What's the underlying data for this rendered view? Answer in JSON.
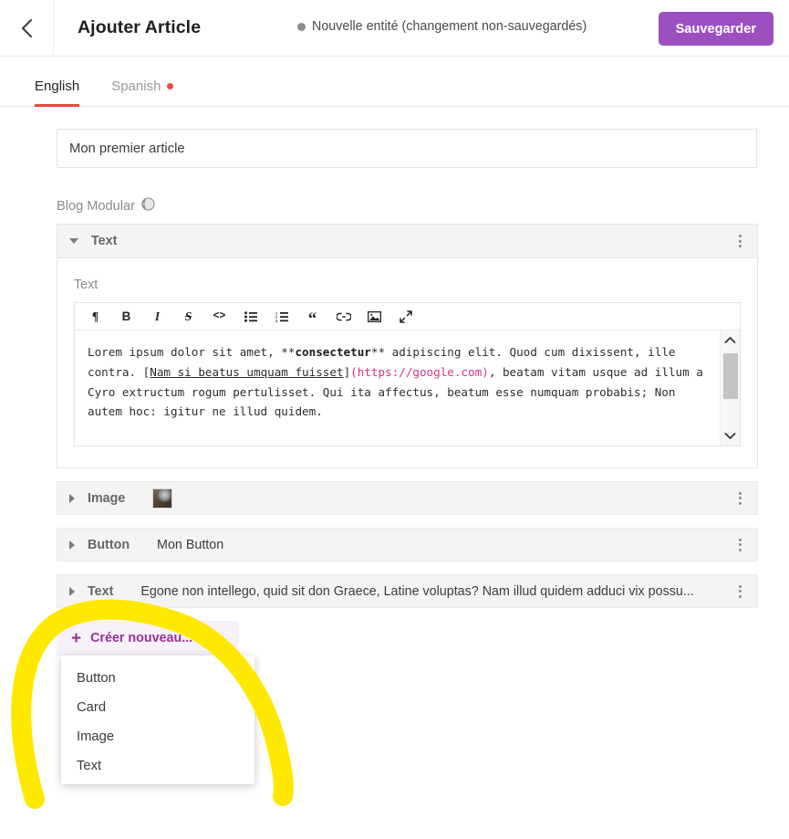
{
  "header": {
    "back_icon": "chevron-left-icon",
    "title": "Ajouter Article",
    "status_text": "Nouvelle entité (changement non-sauvegardés)",
    "status_dot_color": "#8d8d8d",
    "save_label": "Sauvegarder",
    "save_color": "#9b4fc0"
  },
  "tabs": {
    "items": [
      {
        "label": "English",
        "active": true,
        "has_dot": false
      },
      {
        "label": "Spanish",
        "active": false,
        "has_dot": true
      }
    ],
    "active_underline_color": "#e4483b",
    "dot_color": "#ef4b38"
  },
  "form": {
    "title_value": "Mon premier article",
    "title_placeholder": "",
    "modular_label": "Blog Modular",
    "modular_icon": "globe-icon"
  },
  "modules": {
    "expanded": {
      "type": "Text",
      "sub_label": "Text",
      "toolbar": [
        {
          "name": "paragraph-icon",
          "glyph": "¶"
        },
        {
          "name": "bold-icon",
          "glyph": "B"
        },
        {
          "name": "italic-icon",
          "glyph": "I"
        },
        {
          "name": "strikethrough-icon",
          "glyph": "S"
        },
        {
          "name": "code-icon",
          "glyph": "<>"
        },
        {
          "name": "bullet-list-icon",
          "glyph": "☰"
        },
        {
          "name": "numbered-list-icon",
          "glyph": "☰"
        },
        {
          "name": "quote-icon",
          "glyph": "“"
        },
        {
          "name": "link-icon",
          "glyph": "⛓"
        },
        {
          "name": "image-icon",
          "glyph": "▣"
        },
        {
          "name": "fullscreen-icon",
          "glyph": "⤢"
        }
      ],
      "markdown": {
        "part1": "Lorem ipsum dolor sit amet, **",
        "bold": "consectetur",
        "part2": "** adipiscing elit. Quod cum dixissent, ille contra. [",
        "link_text": "Nam si beatus umquam fuisset",
        "part3": "]",
        "url": "(https://google.com)",
        "part4": ", beatam vitam usque ad illum a Cyro extructum rogum pertulisset. Qui ita affectus, beatum esse numquam probabis; Non autem hoc: igitur ne illud quidem."
      }
    },
    "rows": [
      {
        "type": "Image",
        "preview": "",
        "has_thumb": true
      },
      {
        "type": "Button",
        "preview": "Mon Button",
        "has_thumb": false
      },
      {
        "type": "Text",
        "preview": "Egone non intellego, quid sit don Graece, Latine voluptas? Nam illud quidem adduci vix possu...",
        "has_thumb": false
      }
    ]
  },
  "create": {
    "label": "Créer nouveau...",
    "plus_icon": "plus-icon",
    "caret_icon": "caret-up-icon",
    "accent_color": "#96339c",
    "options": [
      "Button",
      "Card",
      "Image",
      "Text"
    ]
  },
  "annotation": {
    "name": "yellow-highlight-stroke",
    "color": "#FFE800"
  }
}
